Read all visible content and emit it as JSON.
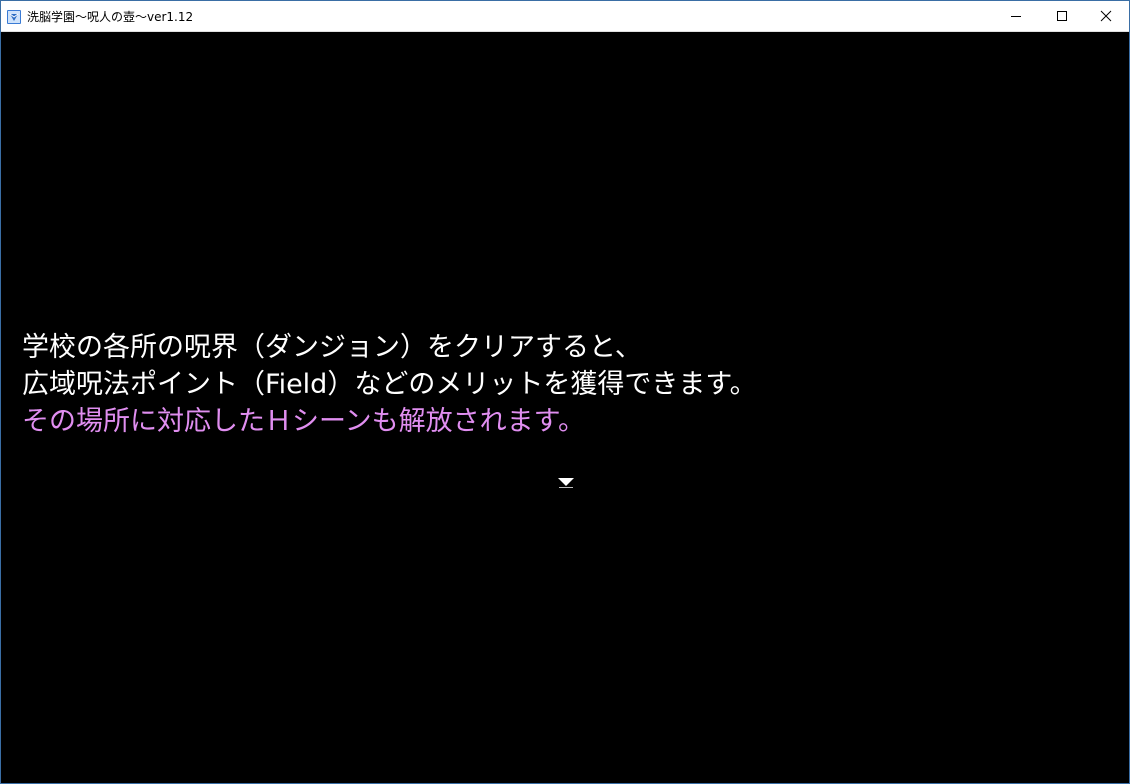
{
  "window": {
    "title": "洗脳学園～呪人の壺～ver1.12",
    "controls": {
      "minimize": "minimize-icon",
      "maximize": "maximize-icon",
      "close": "close-icon"
    }
  },
  "message": {
    "lines": [
      "学校の各所の呪界（ダンジョン）をクリアすると、",
      "広域呪法ポイント（Field）などのメリットを獲得できます。",
      "その場所に対応したＨシーンも解放されます。"
    ],
    "highlight_color": "#e08ef0",
    "text_color": "#ffffff"
  },
  "pause_indicator": "triangle-down-icon",
  "colors": {
    "background": "#000000",
    "titlebar": "#ffffff",
    "window_border": "#3a6ea5"
  }
}
